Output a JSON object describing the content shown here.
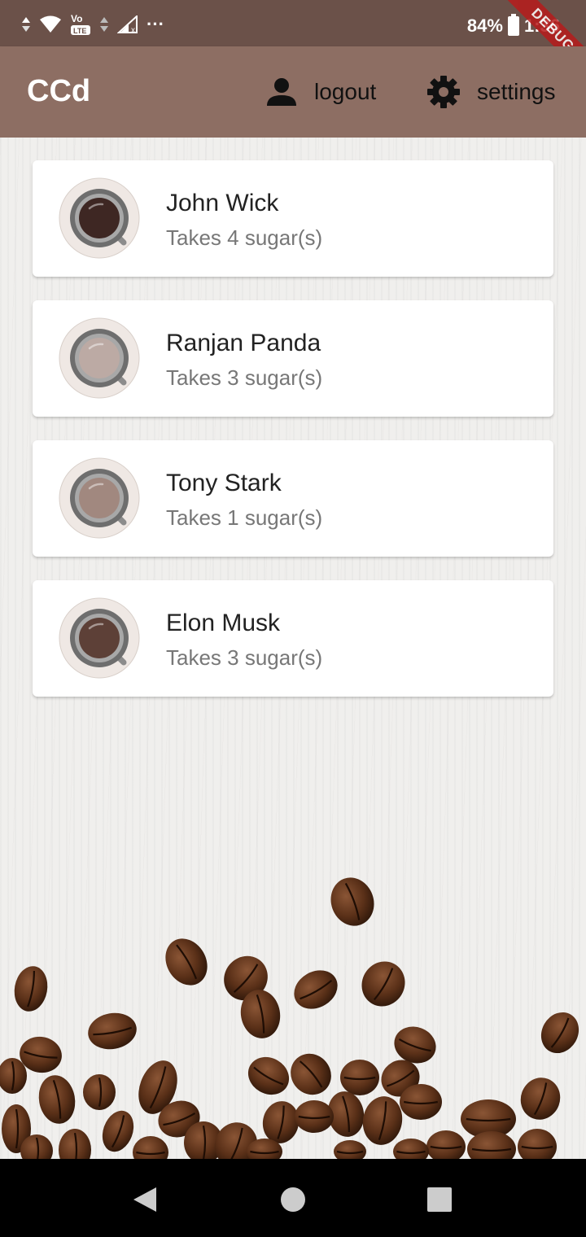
{
  "status_bar": {
    "battery_percent": "84%",
    "time": "1:36",
    "more_indicator": "···",
    "debug_banner": "DEBUG",
    "icons": [
      "data-arrows-icon",
      "wifi-icon",
      "volte-icon",
      "signal-icon",
      "battery-icon"
    ]
  },
  "app_bar": {
    "title": "CCd",
    "logout_label": "logout",
    "settings_label": "settings",
    "logout_icon": "person-icon",
    "settings_icon": "gear-icon",
    "color": "#8d6e63"
  },
  "people": [
    {
      "name": "John Wick",
      "subtitle": "Takes 4 sugar(s)",
      "coffee_color": "#3e2723"
    },
    {
      "name": "Ranjan Panda",
      "subtitle": "Takes 3 sugar(s)",
      "coffee_color": "#bcaaa4"
    },
    {
      "name": "Tony Stark",
      "subtitle": "Takes 1 sugar(s)",
      "coffee_color": "#a1887f"
    },
    {
      "name": "Elon Musk",
      "subtitle": "Takes 3 sugar(s)",
      "coffee_color": "#5d4037"
    }
  ],
  "nav_bar": {
    "icons": [
      "back-icon",
      "home-icon",
      "recents-icon"
    ]
  }
}
